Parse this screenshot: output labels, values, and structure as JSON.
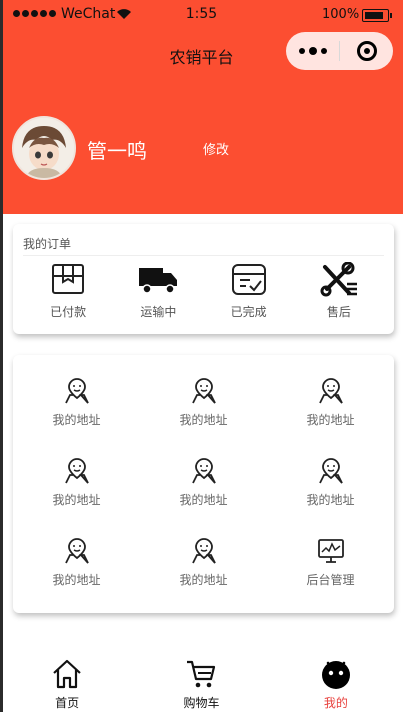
{
  "status_bar": {
    "carrier": "WeChat",
    "time": "1:55",
    "battery": "100%"
  },
  "nav": {
    "title": "农销平台"
  },
  "profile": {
    "username": "管一鸣",
    "edit_label": "修改"
  },
  "orders": {
    "title": "我的订单",
    "items": [
      {
        "label": "已付款",
        "icon": "package-icon"
      },
      {
        "label": "运输中",
        "icon": "truck-icon"
      },
      {
        "label": "已完成",
        "icon": "completed-box-icon"
      },
      {
        "label": "售后",
        "icon": "tools-icon"
      }
    ]
  },
  "grid": {
    "items": [
      {
        "label": "我的地址",
        "icon": "location-person-icon"
      },
      {
        "label": "我的地址",
        "icon": "location-person-icon"
      },
      {
        "label": "我的地址",
        "icon": "location-person-icon"
      },
      {
        "label": "我的地址",
        "icon": "location-person-icon"
      },
      {
        "label": "我的地址",
        "icon": "location-person-icon"
      },
      {
        "label": "我的地址",
        "icon": "location-person-icon"
      },
      {
        "label": "我的地址",
        "icon": "location-person-icon"
      },
      {
        "label": "我的地址",
        "icon": "location-person-icon"
      },
      {
        "label": "后台管理",
        "icon": "monitor-chart-icon"
      }
    ]
  },
  "tabbar": {
    "items": [
      {
        "label": "首页",
        "icon": "home-icon",
        "active": false
      },
      {
        "label": "购物车",
        "icon": "cart-icon",
        "active": false
      },
      {
        "label": "我的",
        "icon": "profile-face-icon",
        "active": true
      }
    ],
    "active_color": "#e8413d"
  },
  "colors": {
    "header_bg": "#fc4e31",
    "accent": "#e8413d"
  }
}
